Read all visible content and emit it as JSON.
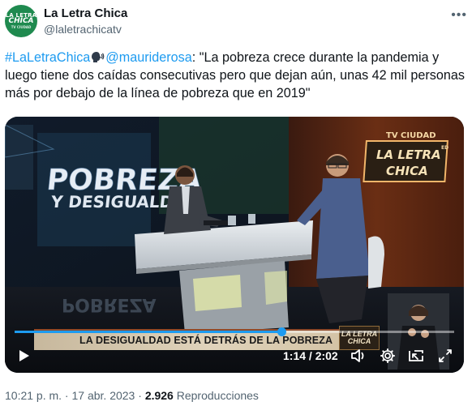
{
  "account": {
    "name": "La Letra Chica",
    "handle": "@laletrachicatv",
    "avatar_lines": [
      "LA LETRA",
      "CHICA",
      "TV CIUDAD"
    ]
  },
  "tweet": {
    "hashtag": "#LaLetraChica",
    "emoji": "speaking-head-icon",
    "mention": "@mauriderosa",
    "text": ": \"La pobreza crece durante la pandemia y luego tiene dos caídas consecutivas pero que dejan aún, unas 42 mil personas más por debajo de la línea de pobreza que en 2019\""
  },
  "video": {
    "wall_title": [
      "POBREZA",
      "Y DESIGUALDAD"
    ],
    "set_sign": [
      "TV CIUDAD",
      "LA LETRA",
      "CHICA",
      "ED"
    ],
    "lower_third": "LA DESIGUALDAD ESTÁ DETRÁS DE LA POBREZA",
    "lower_third_logo": [
      "LA LETRA",
      "CHICA"
    ],
    "time": "1:14 / 2:02",
    "progress": 0.607,
    "icons": {
      "play": "play-icon",
      "volume": "volume-icon",
      "settings": "gear-icon",
      "pip": "picture-in-picture-icon",
      "fullscreen": "fullscreen-icon"
    }
  },
  "meta": {
    "time": "10:21 p. m.",
    "separator": " · ",
    "date": "17 abr. 2023",
    "views": "2.926",
    "views_label": "Reproducciones"
  },
  "colors": {
    "link": "#1d9bf0",
    "text": "#0f1419",
    "muted": "#536471",
    "avatar_bg": "#1f8a4f"
  }
}
